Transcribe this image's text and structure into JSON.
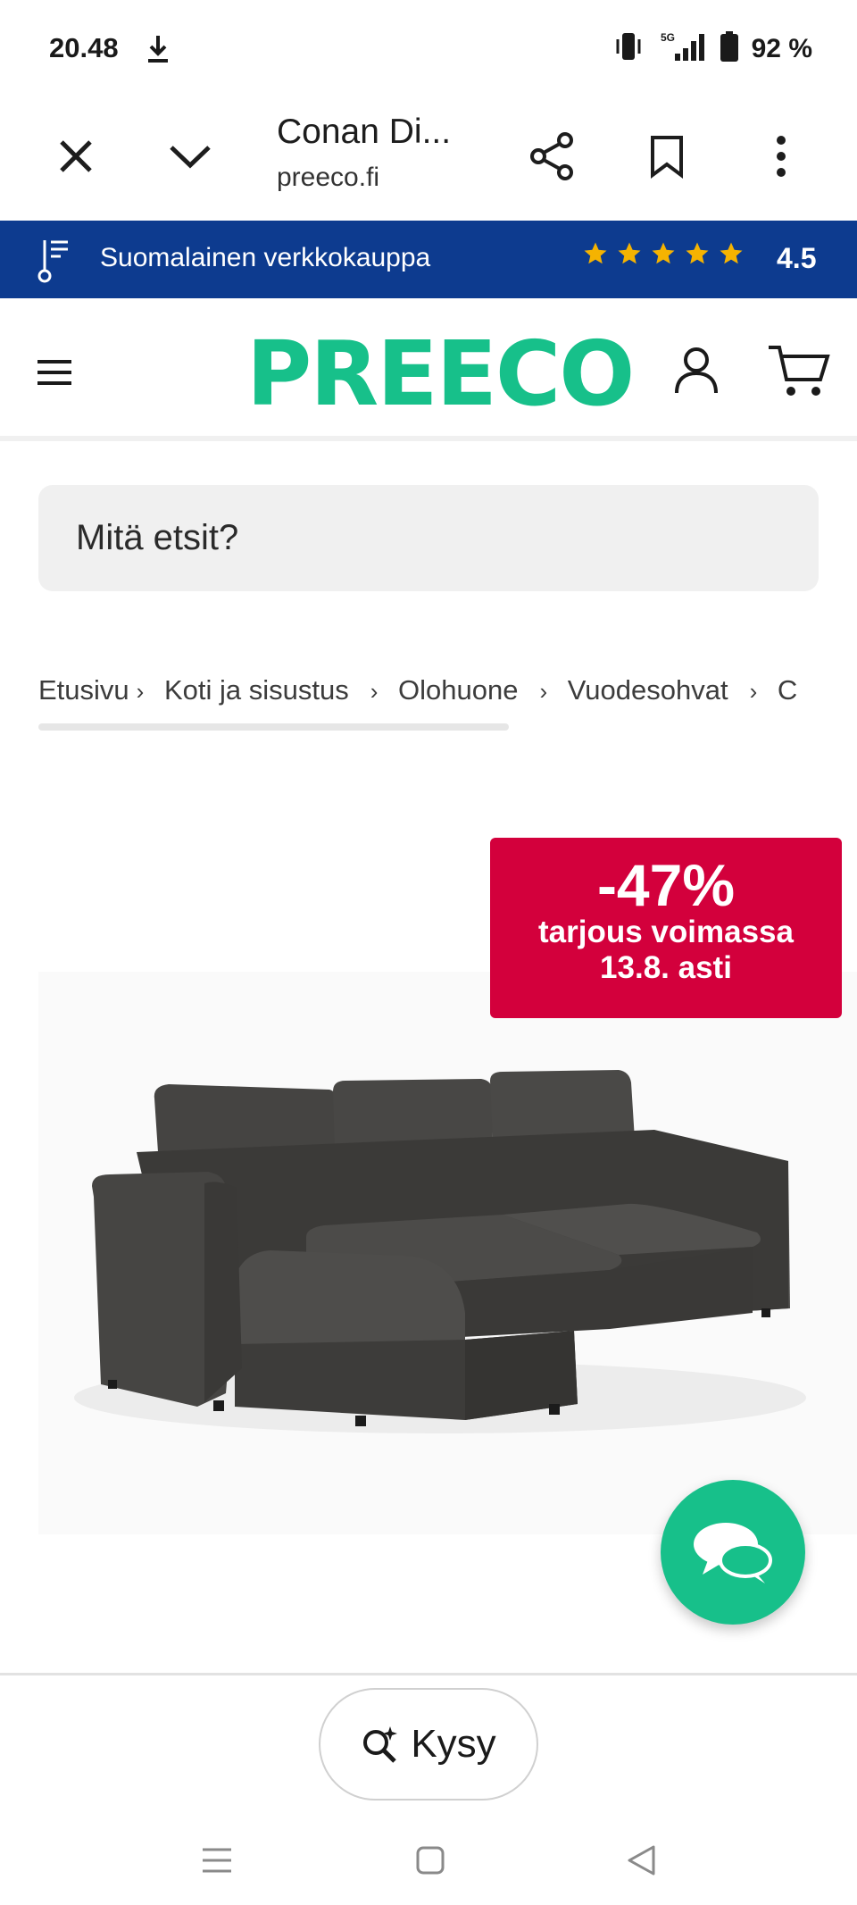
{
  "status": {
    "time": "20.48",
    "battery": "92 %",
    "network": "5G"
  },
  "browser": {
    "title": "Conan Di...",
    "url": "preeco.fi"
  },
  "trust": {
    "text": "Suomalainen verkkokauppa",
    "rating": "4.5",
    "stars": 5
  },
  "header": {
    "logo": "PREECO"
  },
  "search": {
    "placeholder": "Mitä etsit?",
    "value": ""
  },
  "breadcrumb": {
    "items": [
      {
        "label": "Etusivu"
      },
      {
        "label": "Koti ja sisustus"
      },
      {
        "label": "Olohuone"
      },
      {
        "label": "Vuodesohvat"
      },
      {
        "label": "C"
      }
    ],
    "separator": "›"
  },
  "discount": {
    "percent": "-47%",
    "line1": "tarjous voimassa",
    "line2": "13.8. asti"
  },
  "product": {
    "color": "#3d3c3a"
  },
  "ask": {
    "label": "Kysy"
  },
  "colors": {
    "brand": "#17c08a",
    "trust_bg": "#0d3b8f",
    "sale": "#d3003c",
    "star": "#f5b301"
  }
}
